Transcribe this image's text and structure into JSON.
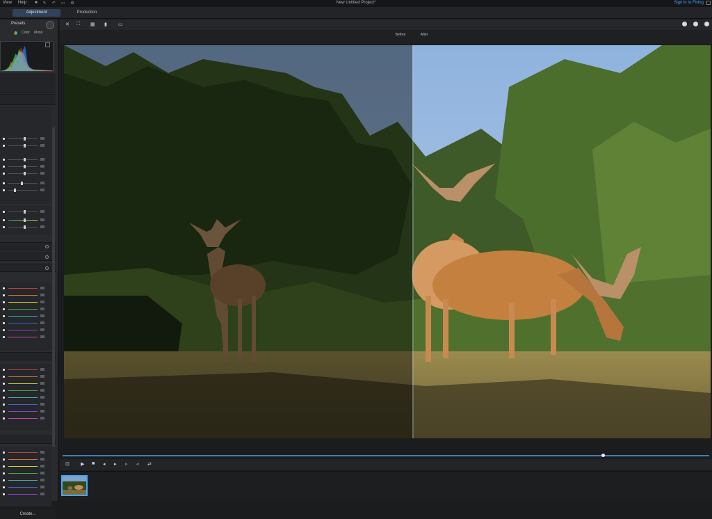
{
  "menu": {
    "view": "View",
    "help": "Help"
  },
  "window": {
    "title": "New Untitled Project*",
    "signin": "Sign in to Fixing"
  },
  "modes": {
    "adjustment": "Adjustment",
    "production": "Production"
  },
  "left_panel": {
    "presets_label": "Presets",
    "hist_tabs": {
      "color": "Color",
      "mono": "Mono"
    },
    "create_button": "Create..."
  },
  "viewer": {
    "before_label": "Before",
    "after_label": "After"
  },
  "playback": {
    "position_fraction": 0.835
  },
  "colors": {
    "accent": "#4aa3ff",
    "mode_active": "#30435a",
    "panel": "#2a2b2e"
  },
  "icons": [
    "checkmark-icon",
    "tool-icon",
    "slideshow-icon",
    "delete-icon",
    "crop-icon",
    "moon-icon",
    "play-icon",
    "stop-icon",
    "prev-icon",
    "next-icon",
    "volume-icon",
    "link-icon"
  ]
}
